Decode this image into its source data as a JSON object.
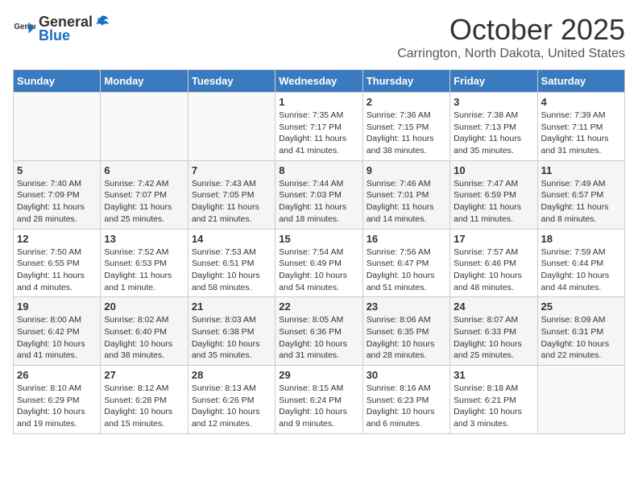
{
  "header": {
    "logo_general": "General",
    "logo_blue": "Blue",
    "month_title": "October 2025",
    "location": "Carrington, North Dakota, United States"
  },
  "days_of_week": [
    "Sunday",
    "Monday",
    "Tuesday",
    "Wednesday",
    "Thursday",
    "Friday",
    "Saturday"
  ],
  "weeks": [
    [
      {
        "day": "",
        "info": ""
      },
      {
        "day": "",
        "info": ""
      },
      {
        "day": "",
        "info": ""
      },
      {
        "day": "1",
        "info": "Sunrise: 7:35 AM\nSunset: 7:17 PM\nDaylight: 11 hours and 41 minutes."
      },
      {
        "day": "2",
        "info": "Sunrise: 7:36 AM\nSunset: 7:15 PM\nDaylight: 11 hours and 38 minutes."
      },
      {
        "day": "3",
        "info": "Sunrise: 7:38 AM\nSunset: 7:13 PM\nDaylight: 11 hours and 35 minutes."
      },
      {
        "day": "4",
        "info": "Sunrise: 7:39 AM\nSunset: 7:11 PM\nDaylight: 11 hours and 31 minutes."
      }
    ],
    [
      {
        "day": "5",
        "info": "Sunrise: 7:40 AM\nSunset: 7:09 PM\nDaylight: 11 hours and 28 minutes."
      },
      {
        "day": "6",
        "info": "Sunrise: 7:42 AM\nSunset: 7:07 PM\nDaylight: 11 hours and 25 minutes."
      },
      {
        "day": "7",
        "info": "Sunrise: 7:43 AM\nSunset: 7:05 PM\nDaylight: 11 hours and 21 minutes."
      },
      {
        "day": "8",
        "info": "Sunrise: 7:44 AM\nSunset: 7:03 PM\nDaylight: 11 hours and 18 minutes."
      },
      {
        "day": "9",
        "info": "Sunrise: 7:46 AM\nSunset: 7:01 PM\nDaylight: 11 hours and 14 minutes."
      },
      {
        "day": "10",
        "info": "Sunrise: 7:47 AM\nSunset: 6:59 PM\nDaylight: 11 hours and 11 minutes."
      },
      {
        "day": "11",
        "info": "Sunrise: 7:49 AM\nSunset: 6:57 PM\nDaylight: 11 hours and 8 minutes."
      }
    ],
    [
      {
        "day": "12",
        "info": "Sunrise: 7:50 AM\nSunset: 6:55 PM\nDaylight: 11 hours and 4 minutes."
      },
      {
        "day": "13",
        "info": "Sunrise: 7:52 AM\nSunset: 6:53 PM\nDaylight: 11 hours and 1 minute."
      },
      {
        "day": "14",
        "info": "Sunrise: 7:53 AM\nSunset: 6:51 PM\nDaylight: 10 hours and 58 minutes."
      },
      {
        "day": "15",
        "info": "Sunrise: 7:54 AM\nSunset: 6:49 PM\nDaylight: 10 hours and 54 minutes."
      },
      {
        "day": "16",
        "info": "Sunrise: 7:56 AM\nSunset: 6:47 PM\nDaylight: 10 hours and 51 minutes."
      },
      {
        "day": "17",
        "info": "Sunrise: 7:57 AM\nSunset: 6:46 PM\nDaylight: 10 hours and 48 minutes."
      },
      {
        "day": "18",
        "info": "Sunrise: 7:59 AM\nSunset: 6:44 PM\nDaylight: 10 hours and 44 minutes."
      }
    ],
    [
      {
        "day": "19",
        "info": "Sunrise: 8:00 AM\nSunset: 6:42 PM\nDaylight: 10 hours and 41 minutes."
      },
      {
        "day": "20",
        "info": "Sunrise: 8:02 AM\nSunset: 6:40 PM\nDaylight: 10 hours and 38 minutes."
      },
      {
        "day": "21",
        "info": "Sunrise: 8:03 AM\nSunset: 6:38 PM\nDaylight: 10 hours and 35 minutes."
      },
      {
        "day": "22",
        "info": "Sunrise: 8:05 AM\nSunset: 6:36 PM\nDaylight: 10 hours and 31 minutes."
      },
      {
        "day": "23",
        "info": "Sunrise: 8:06 AM\nSunset: 6:35 PM\nDaylight: 10 hours and 28 minutes."
      },
      {
        "day": "24",
        "info": "Sunrise: 8:07 AM\nSunset: 6:33 PM\nDaylight: 10 hours and 25 minutes."
      },
      {
        "day": "25",
        "info": "Sunrise: 8:09 AM\nSunset: 6:31 PM\nDaylight: 10 hours and 22 minutes."
      }
    ],
    [
      {
        "day": "26",
        "info": "Sunrise: 8:10 AM\nSunset: 6:29 PM\nDaylight: 10 hours and 19 minutes."
      },
      {
        "day": "27",
        "info": "Sunrise: 8:12 AM\nSunset: 6:28 PM\nDaylight: 10 hours and 15 minutes."
      },
      {
        "day": "28",
        "info": "Sunrise: 8:13 AM\nSunset: 6:26 PM\nDaylight: 10 hours and 12 minutes."
      },
      {
        "day": "29",
        "info": "Sunrise: 8:15 AM\nSunset: 6:24 PM\nDaylight: 10 hours and 9 minutes."
      },
      {
        "day": "30",
        "info": "Sunrise: 8:16 AM\nSunset: 6:23 PM\nDaylight: 10 hours and 6 minutes."
      },
      {
        "day": "31",
        "info": "Sunrise: 8:18 AM\nSunset: 6:21 PM\nDaylight: 10 hours and 3 minutes."
      },
      {
        "day": "",
        "info": ""
      }
    ]
  ]
}
